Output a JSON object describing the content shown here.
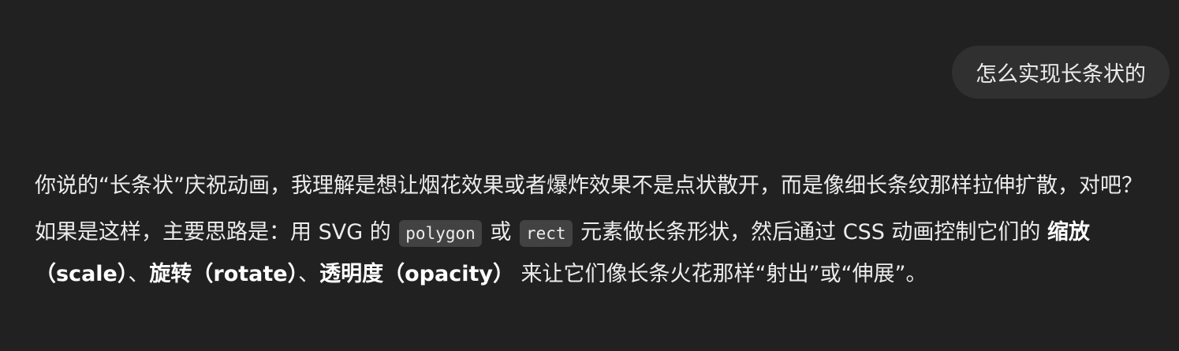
{
  "user_message": {
    "text": "怎么实现长条状的"
  },
  "assistant_message": {
    "p1": "你说的“长条状”庆祝动画，我理解是想让烟花效果或者爆炸效果不是点状散开，而是像细长条纹那样拉伸扩散，对吧？",
    "p2": {
      "t1": "如果是这样，主要思路是：用 SVG 的 ",
      "code1": "polygon",
      "t2": " 或 ",
      "code2": "rect",
      "t3": " 元素做长条形状，然后通过 CSS 动画控制它们的 ",
      "b1": "缩放（scale）",
      "t4": "、",
      "b2": "旋转（rotate）",
      "t5": "、",
      "b3": "透明度（opacity）",
      "t6": " 来让它们像长条火花那样“射出”或“伸展”。"
    }
  },
  "colors": {
    "background": "#212121",
    "user_bubble": "#303030",
    "inline_code_bg": "#424242",
    "text": "#ececec"
  }
}
